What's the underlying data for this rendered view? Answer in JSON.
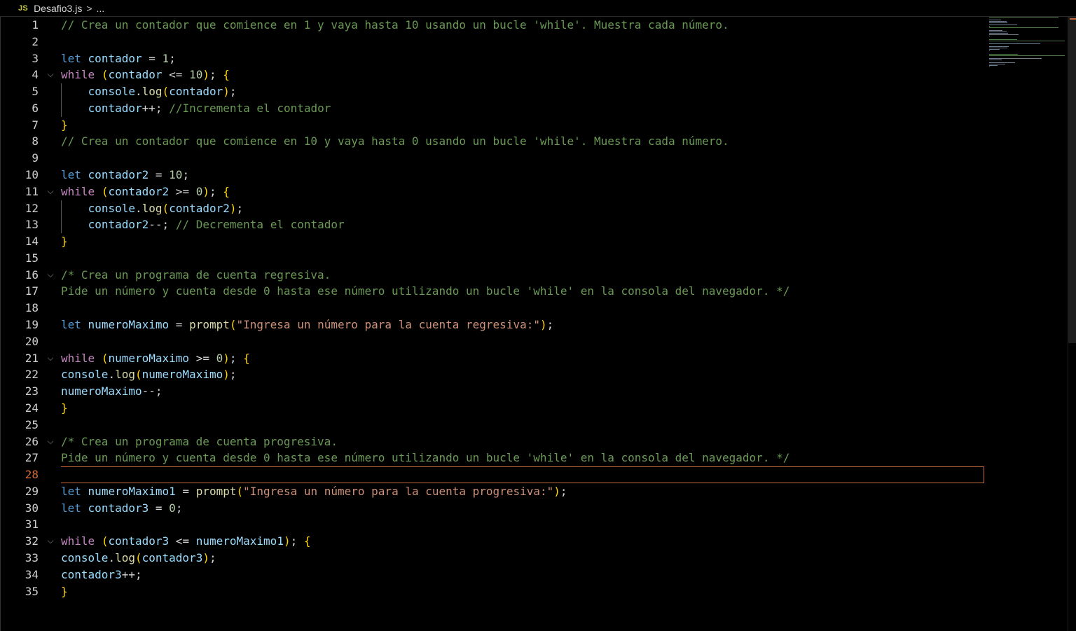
{
  "breadcrumb": {
    "file_type_badge": "JS",
    "file_name": "Desafio3.js",
    "separator": ">",
    "ellipsis": "..."
  },
  "editor": {
    "active_line": 28,
    "lines": [
      {
        "n": "1",
        "text": "// Crea un contador que comience en 1 y vaya hasta 10 usando un bucle 'while'. Muestra cada número."
      },
      {
        "n": "2",
        "text": ""
      },
      {
        "n": "3",
        "text": "let contador = 1;"
      },
      {
        "n": "4",
        "text": "while (contador <= 10); {",
        "fold": true
      },
      {
        "n": "5",
        "text": "    console.log(contador);"
      },
      {
        "n": "6",
        "text": "    contador++; //Incrementa el contador"
      },
      {
        "n": "7",
        "text": "}"
      },
      {
        "n": "8",
        "text": "// Crea un contador que comience en 10 y vaya hasta 0 usando un bucle 'while'. Muestra cada número."
      },
      {
        "n": "9",
        "text": ""
      },
      {
        "n": "10",
        "text": "let contador2 = 10;"
      },
      {
        "n": "11",
        "text": "while (contador2 >= 0); {",
        "fold": true
      },
      {
        "n": "12",
        "text": "    console.log(contador2);"
      },
      {
        "n": "13",
        "text": "    contador2--; // Decrementa el contador"
      },
      {
        "n": "14",
        "text": "}"
      },
      {
        "n": "15",
        "text": ""
      },
      {
        "n": "16",
        "text": "/* Crea un programa de cuenta regresiva.",
        "fold": true
      },
      {
        "n": "17",
        "text": "Pide un número y cuenta desde 0 hasta ese número utilizando un bucle 'while' en la consola del navegador. */"
      },
      {
        "n": "18",
        "text": ""
      },
      {
        "n": "19",
        "text": "let numeroMaximo = prompt(\"Ingresa un número para la cuenta regresiva:\");"
      },
      {
        "n": "20",
        "text": ""
      },
      {
        "n": "21",
        "text": "while (numeroMaximo >= 0); {",
        "fold": true
      },
      {
        "n": "22",
        "text": "console.log(numeroMaximo);"
      },
      {
        "n": "23",
        "text": "numeroMaximo--;"
      },
      {
        "n": "24",
        "text": "}"
      },
      {
        "n": "25",
        "text": ""
      },
      {
        "n": "26",
        "text": "/* Crea un programa de cuenta progresiva.",
        "fold": true
      },
      {
        "n": "27",
        "text": "Pide un número y cuenta desde 0 hasta ese número utilizando un bucle 'while' en la consola del navegador. */"
      },
      {
        "n": "28",
        "text": ""
      },
      {
        "n": "29",
        "text": "let numeroMaximo1 = prompt(\"Ingresa un número para la cuenta progresiva:\");"
      },
      {
        "n": "30",
        "text": "let contador3 = 0;"
      },
      {
        "n": "31",
        "text": ""
      },
      {
        "n": "32",
        "text": "while (contador3 <= numeroMaximo1); {",
        "fold": true
      },
      {
        "n": "33",
        "text": "console.log(contador3);"
      },
      {
        "n": "34",
        "text": "contador3++;"
      },
      {
        "n": "35",
        "text": "}"
      }
    ]
  },
  "icons": {
    "fold_icon": "chevron-down-icon",
    "separator_icon": "chevron-right-icon"
  },
  "colors": {
    "background": "#000000",
    "comment": "#6a9955",
    "keyword": "#569cd6",
    "control": "#c586c0",
    "variable": "#9cdcfe",
    "number": "#b5cea8",
    "function": "#dcdcaa",
    "string": "#ce9178",
    "bracket_level1": "#ffd700",
    "bracket_level2": "#da70d6",
    "active_line_border": "#c1693a",
    "active_line_number": "#d06a3a"
  }
}
